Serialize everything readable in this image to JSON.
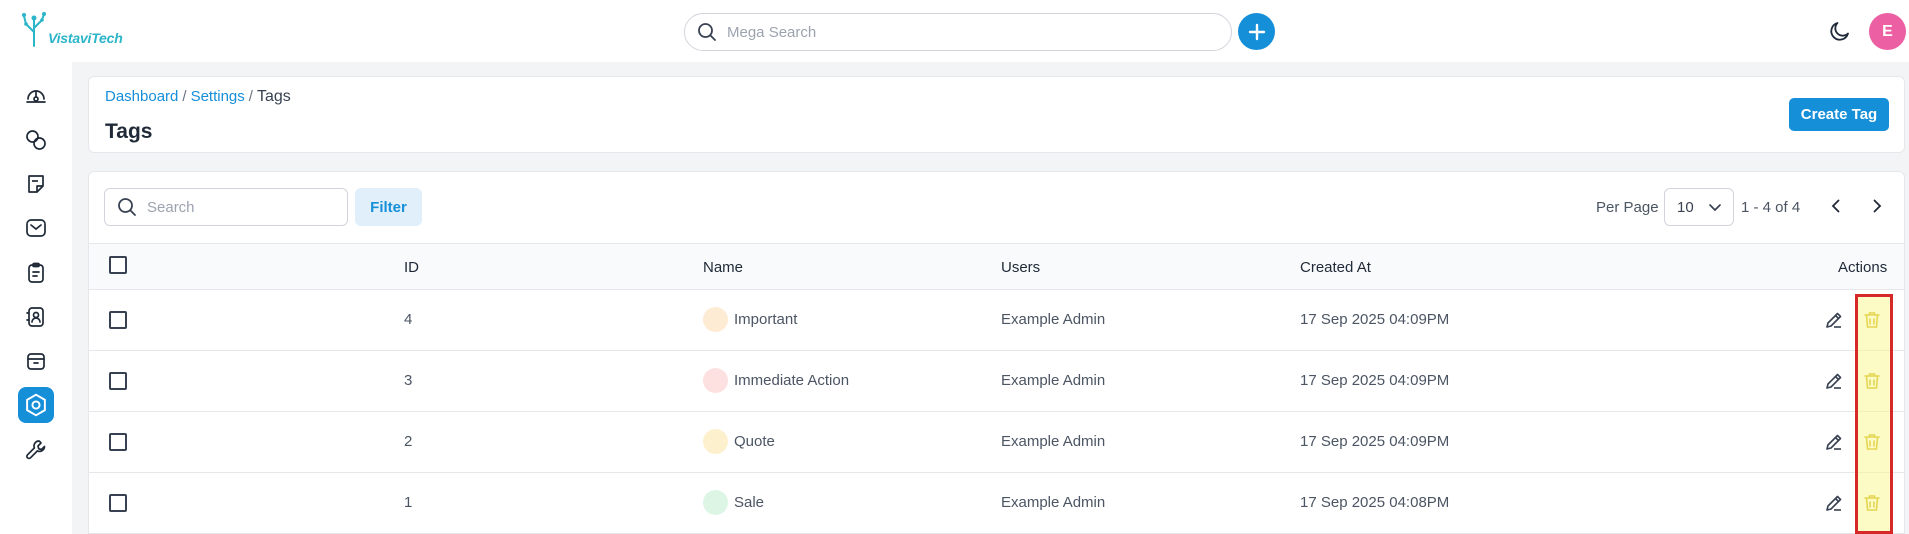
{
  "app": {
    "logo_text": "VistaviTech",
    "brand_color": "#168fd9"
  },
  "topbar": {
    "search_placeholder": "Mega Search",
    "avatar_initial": "E"
  },
  "sidebar": {
    "items": [
      {
        "icon": "dashboard-gauge-icon"
      },
      {
        "icon": "integrations-link-icon"
      },
      {
        "icon": "notes-icon"
      },
      {
        "icon": "inbox-mail-icon"
      },
      {
        "icon": "clipboard-icon"
      },
      {
        "icon": "contacts-book-icon"
      },
      {
        "icon": "archive-box-icon"
      },
      {
        "icon": "settings-gear-icon",
        "active": true
      },
      {
        "icon": "wrench-icon"
      }
    ]
  },
  "header": {
    "breadcrumb": [
      "Dashboard",
      "Settings",
      "Tags"
    ],
    "separator": "/",
    "title": "Tags",
    "create_label": "Create Tag"
  },
  "toolbar": {
    "search_placeholder": "Search",
    "filter_label": "Filter",
    "per_page_label": "Per Page",
    "per_page_value": "10",
    "range_text": "1 - 4 of 4"
  },
  "table": {
    "columns": [
      "ID",
      "Name",
      "Users",
      "Created At",
      "Actions"
    ],
    "rows": [
      {
        "id": "4",
        "name": "Important",
        "color": "#fdebd3",
        "users": "Example Admin",
        "created_at": "17 Sep 2025 04:09PM"
      },
      {
        "id": "3",
        "name": "Immediate Action",
        "color": "#fde0e0",
        "users": "Example Admin",
        "created_at": "17 Sep 2025 04:09PM"
      },
      {
        "id": "2",
        "name": "Quote",
        "color": "#fdf0cc",
        "users": "Example Admin",
        "created_at": "17 Sep 2025 04:09PM"
      },
      {
        "id": "1",
        "name": "Sale",
        "color": "#dcf5e4",
        "users": "Example Admin",
        "created_at": "17 Sep 2025 04:08PM"
      }
    ]
  },
  "colors": {
    "delete_icon": "#c9b000",
    "highlight_border": "#d62828"
  }
}
